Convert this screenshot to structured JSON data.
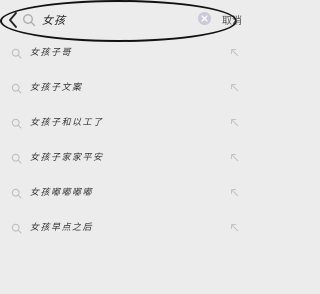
{
  "search": {
    "query": "女孩",
    "cancel_label": "取消"
  },
  "suggestions": [
    {
      "text": "女孩子哥"
    },
    {
      "text": "女孩子文案"
    },
    {
      "text": "女孩子和以工了"
    },
    {
      "text": "女孩子家家平安"
    },
    {
      "text": "女孩嘟嘟嘟嘟"
    },
    {
      "text": "女孩早点之后"
    }
  ],
  "icons": {
    "back": "chevron-left-icon",
    "search": "search-icon",
    "clear": "clear-icon",
    "suggestion": "search-icon",
    "fill": "arrow-up-left-icon"
  },
  "colors": {
    "background": "#ececec",
    "clear_button": "#c9c9d8"
  }
}
